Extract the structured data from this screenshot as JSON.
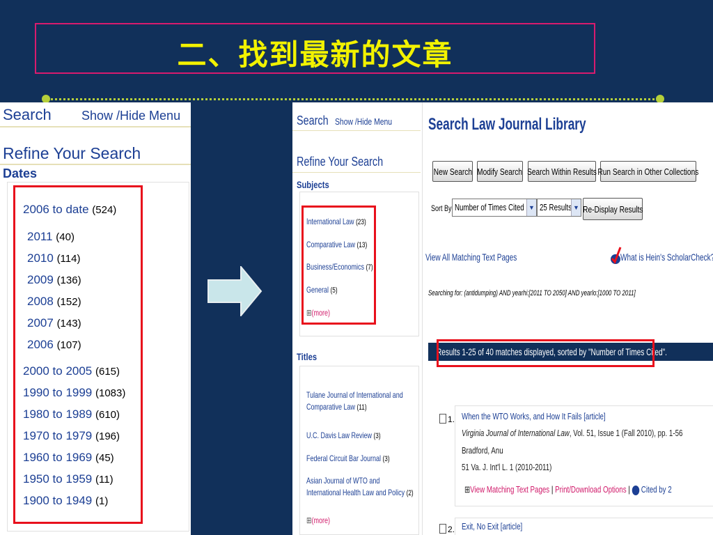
{
  "slide_title": "二、找到最新的文章",
  "left_panel": {
    "search": "Search",
    "show_hide": "Show /Hide Menu",
    "refine": "Refine Your Search",
    "dates_label": "Dates",
    "date_ranges": [
      {
        "label": "2006 to date",
        "count": "(524)"
      },
      {
        "label": "2011",
        "count": "(40)"
      },
      {
        "label": "2010",
        "count": "(114)"
      },
      {
        "label": "2009",
        "count": "(136)"
      },
      {
        "label": "2008",
        "count": "(152)"
      },
      {
        "label": "2007",
        "count": "(143)"
      },
      {
        "label": "2006",
        "count": "(107)"
      },
      {
        "label": "2000 to 2005",
        "count": "(615)"
      },
      {
        "label": "1990 to 1999",
        "count": "(1083)"
      },
      {
        "label": "1980 to 1989",
        "count": "(610)"
      },
      {
        "label": "1970 to 1979",
        "count": "(196)"
      },
      {
        "label": "1960 to 1969",
        "count": "(45)"
      },
      {
        "label": "1950 to 1959",
        "count": "(11)"
      },
      {
        "label": "1900 to 1949",
        "count": "(1)"
      }
    ]
  },
  "right_panel": {
    "search": "Search",
    "show_hide": "Show /Hide Menu",
    "refine": "Refine Your Search",
    "subjects_label": "Subjects",
    "subjects": [
      {
        "label": "International Law",
        "count": "(23)"
      },
      {
        "label": "Comparative Law",
        "count": "(13)"
      },
      {
        "label": "Business/Economics",
        "count": "(7)"
      },
      {
        "label": "General",
        "count": "(5)"
      }
    ],
    "more": "(more)",
    "plus": "⊞",
    "titles_label": "Titles",
    "titles": [
      {
        "label": "Tulane Journal of International and Comparative Law",
        "count": "(11)"
      },
      {
        "label": "U.C. Davis Law Review",
        "count": "(3)"
      },
      {
        "label": "Federal Circuit Bar Journal",
        "count": "(3)"
      },
      {
        "label": "Asian Journal of WTO and International Health Law and Policy",
        "count": "(2)"
      }
    ],
    "main": {
      "title": "Search Law Journal Library",
      "buttons": {
        "new_search": "New Search",
        "modify_search": "Modify Search",
        "search_within": "Search Within Results",
        "run_other": "Run Search in Other Collections",
        "redisplay": "Re-Display Results"
      },
      "sort_by_label": "Sort By:",
      "sort_select": "Number of Times Cited",
      "results_select": "25 Results",
      "view_all": "View All Matching Text Pages",
      "scholarcheck": "What is Hein's ScholarCheck?",
      "searching_for": "Searching for: (antidumping) AND yearhi:[2011 TO 2050] AND yearlo:[1000 TO 2011]",
      "results_summary": "Results 1-25 of 40 matches displayed, sorted by \"Number of Times Cited\".",
      "results": [
        {
          "num": "1.",
          "title": "When the WTO Works, and How It Fails [article]",
          "journal": "Virginia Journal of International Law",
          "journal_rest": ", Vol. 51, Issue 1 (Fall 2010), pp. 1-56",
          "author": "Bradford, Anu",
          "citation": "51 Va. J. Int'l L. 1 (2010-2011)",
          "view_matching": "View Matching Text Pages",
          "print_download": "Print/Download Options",
          "cited_by": "Cited by 2",
          "separator": "|"
        },
        {
          "num": "2.",
          "title": "Exit, No Exit [article]"
        }
      ]
    }
  }
}
